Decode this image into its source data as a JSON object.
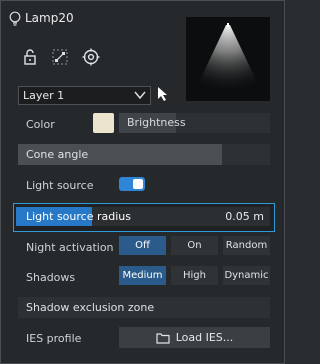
{
  "header": {
    "title": "Lamp20",
    "icons": [
      "bulb-icon",
      "unlock-icon",
      "resize-icon",
      "crosshair-icon"
    ]
  },
  "layer": {
    "selected": "Layer 1"
  },
  "color": {
    "label": "Color",
    "swatch_hex": "#ece4cc",
    "brightness_label": "Brightness",
    "brightness_level": 0.38
  },
  "cone_angle": {
    "label": "Cone angle",
    "level": 0.81
  },
  "light_source": {
    "label": "Light source",
    "enabled": true
  },
  "light_source_radius": {
    "label": "Light source radius",
    "value": "0.05 m",
    "level": 0.3
  },
  "night_activation": {
    "label": "Night activation",
    "options": [
      "Off",
      "On",
      "Random"
    ],
    "selected": "Off"
  },
  "shadows": {
    "label": "Shadows",
    "options": [
      "Medium",
      "High",
      "Dynamic"
    ],
    "selected": "Medium"
  },
  "shadow_exclusion": {
    "label": "Shadow exclusion zone"
  },
  "ies_profile": {
    "label": "IES profile",
    "button_label": "Load IES..."
  },
  "colors": {
    "accent": "#2f86d6",
    "focus_border": "#2f9ad8",
    "active_segment": "#2a5b8a"
  }
}
